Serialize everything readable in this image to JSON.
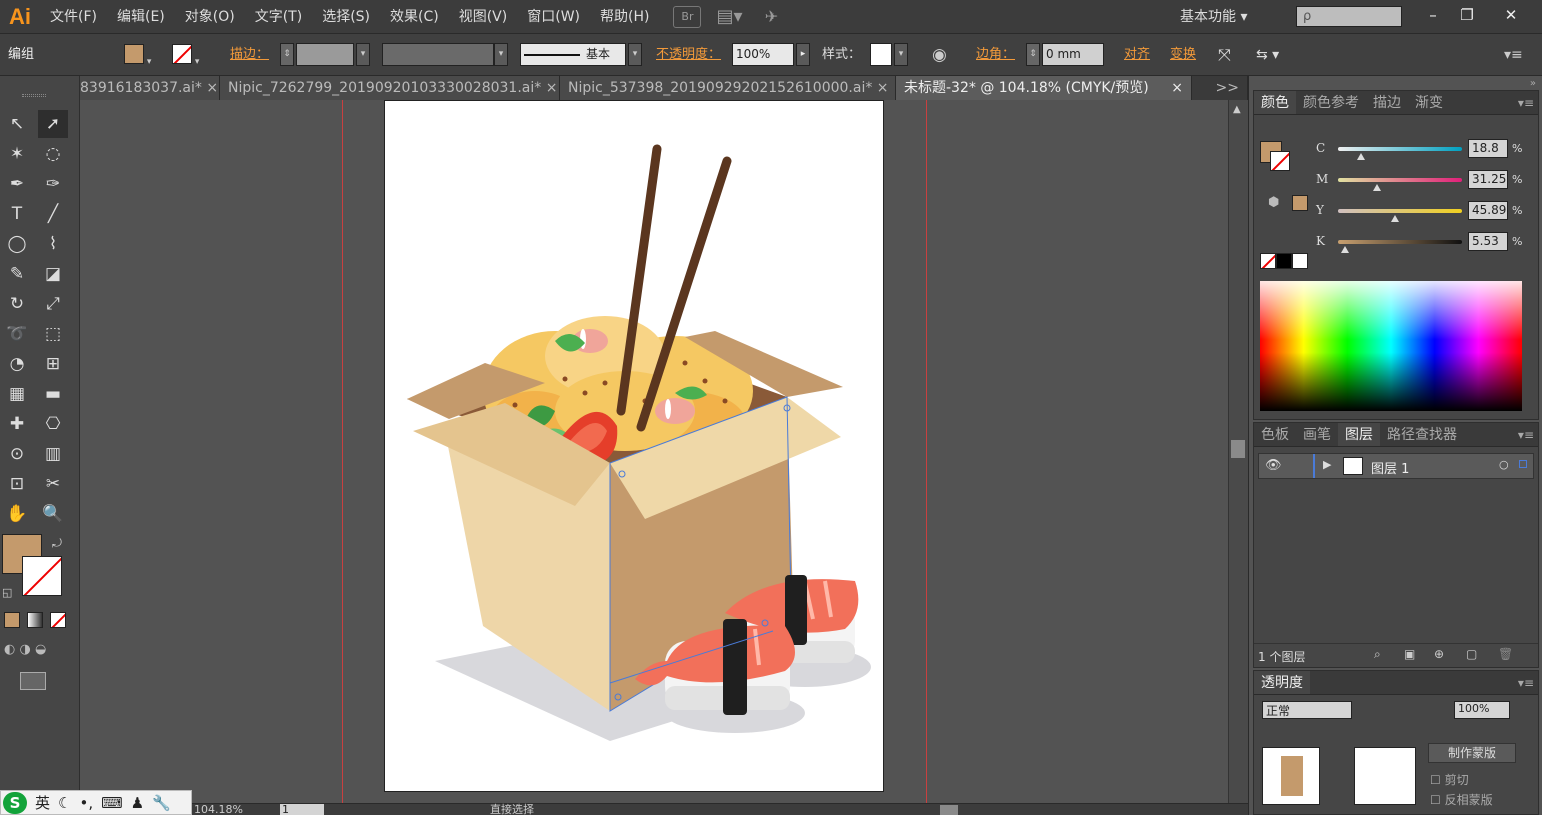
{
  "app": {
    "logo": "Ai",
    "workspace": "基本功能",
    "search_placeholder": "ρ"
  },
  "menu": [
    "文件(F)",
    "编辑(E)",
    "对象(O)",
    "文字(T)",
    "选择(S)",
    "效果(C)",
    "视图(V)",
    "窗口(W)",
    "帮助(H)"
  ],
  "menu_icons": {
    "bridge": "Br"
  },
  "window_controls": {
    "minimize": "–",
    "restore": "❐",
    "close": "✕"
  },
  "control": {
    "group_label": "编组",
    "fill_color": "#c49a6c",
    "stroke_label": "描边：",
    "stroke_style": "基本",
    "opacity_label": "不透明度：",
    "opacity_value": "100%",
    "style_label": "样式：",
    "corner_label": "边角：",
    "corner_value": "0 mm",
    "align_label": "对齐",
    "transform_label": "变换"
  },
  "tabs": [
    {
      "label": "83916183037.ai*",
      "active": false
    },
    {
      "label": "Nipic_7262799_20190920103330028031.ai*",
      "active": false
    },
    {
      "label": "Nipic_537398_20190929202152610000.ai*",
      "active": false
    },
    {
      "label": "未标题-32* @ 104.18% (CMYK/预览)",
      "active": true
    }
  ],
  "tab_close": "×",
  "tab_overflow": ">>",
  "tools": [
    "selection-icon",
    "direct-selection-icon",
    "magic-wand-icon",
    "lasso-icon",
    "pen-icon",
    "curvature-icon",
    "type-icon",
    "line-icon",
    "ellipse-icon",
    "brush-icon",
    "pencil-icon",
    "eraser-icon",
    "rotate-icon",
    "scale-icon",
    "warp-icon",
    "free-transform-icon",
    "shape-builder-icon",
    "perspective-icon",
    "mesh-icon",
    "gradient-icon",
    "eyedropper-icon",
    "blend-icon",
    "symbol-sprayer-icon",
    "column-graph-icon",
    "artboard-icon",
    "slice-icon",
    "hand-icon",
    "zoom-icon"
  ],
  "tool_glyphs": [
    "↖",
    "➚",
    "✶",
    "◌",
    "✒",
    "✑",
    "T",
    "╱",
    "◯",
    "⌇",
    "✎",
    "◪",
    "↻",
    "⤢",
    "➰",
    "⬚",
    "◔",
    "⊞",
    "▦",
    "▬",
    "✚",
    "⎔",
    "⊙",
    "▥",
    "⊡",
    "✂",
    "✋",
    "🔍"
  ],
  "color_panel": {
    "tabs": [
      "颜色",
      "颜色参考",
      "描边",
      "渐变"
    ],
    "fill_color": "#c49a6c",
    "channels": [
      {
        "label": "C",
        "value": "18.8",
        "pos": 0.188,
        "gradient": "linear-gradient(to right,#f0f0f0,#00a0c0)"
      },
      {
        "label": "M",
        "value": "31.25",
        "pos": 0.3125,
        "gradient": "linear-gradient(to right,#e0e0a0,#e0207a)"
      },
      {
        "label": "Y",
        "value": "45.89",
        "pos": 0.4589,
        "gradient": "linear-gradient(to right,#d0c0c0,#f0d020)"
      },
      {
        "label": "K",
        "value": "5.53",
        "pos": 0.0553,
        "gradient": "linear-gradient(to right,#c8a070,#101010)"
      }
    ],
    "percent": "%"
  },
  "layers_panel": {
    "tabs": [
      "色板",
      "画笔",
      "图层",
      "路径查找器"
    ],
    "layer_name": "图层 1",
    "count": "1 个图层"
  },
  "transparency_panel": {
    "tab": "透明度",
    "mode": "正常",
    "opacity": "100%",
    "make_mask": "制作蒙版",
    "clip": "剪切",
    "invert": "反相蒙版"
  },
  "status": {
    "zoom": "104.18%",
    "artboard": "1",
    "tool_name": "直接选择"
  },
  "ime": {
    "lang": "英"
  }
}
